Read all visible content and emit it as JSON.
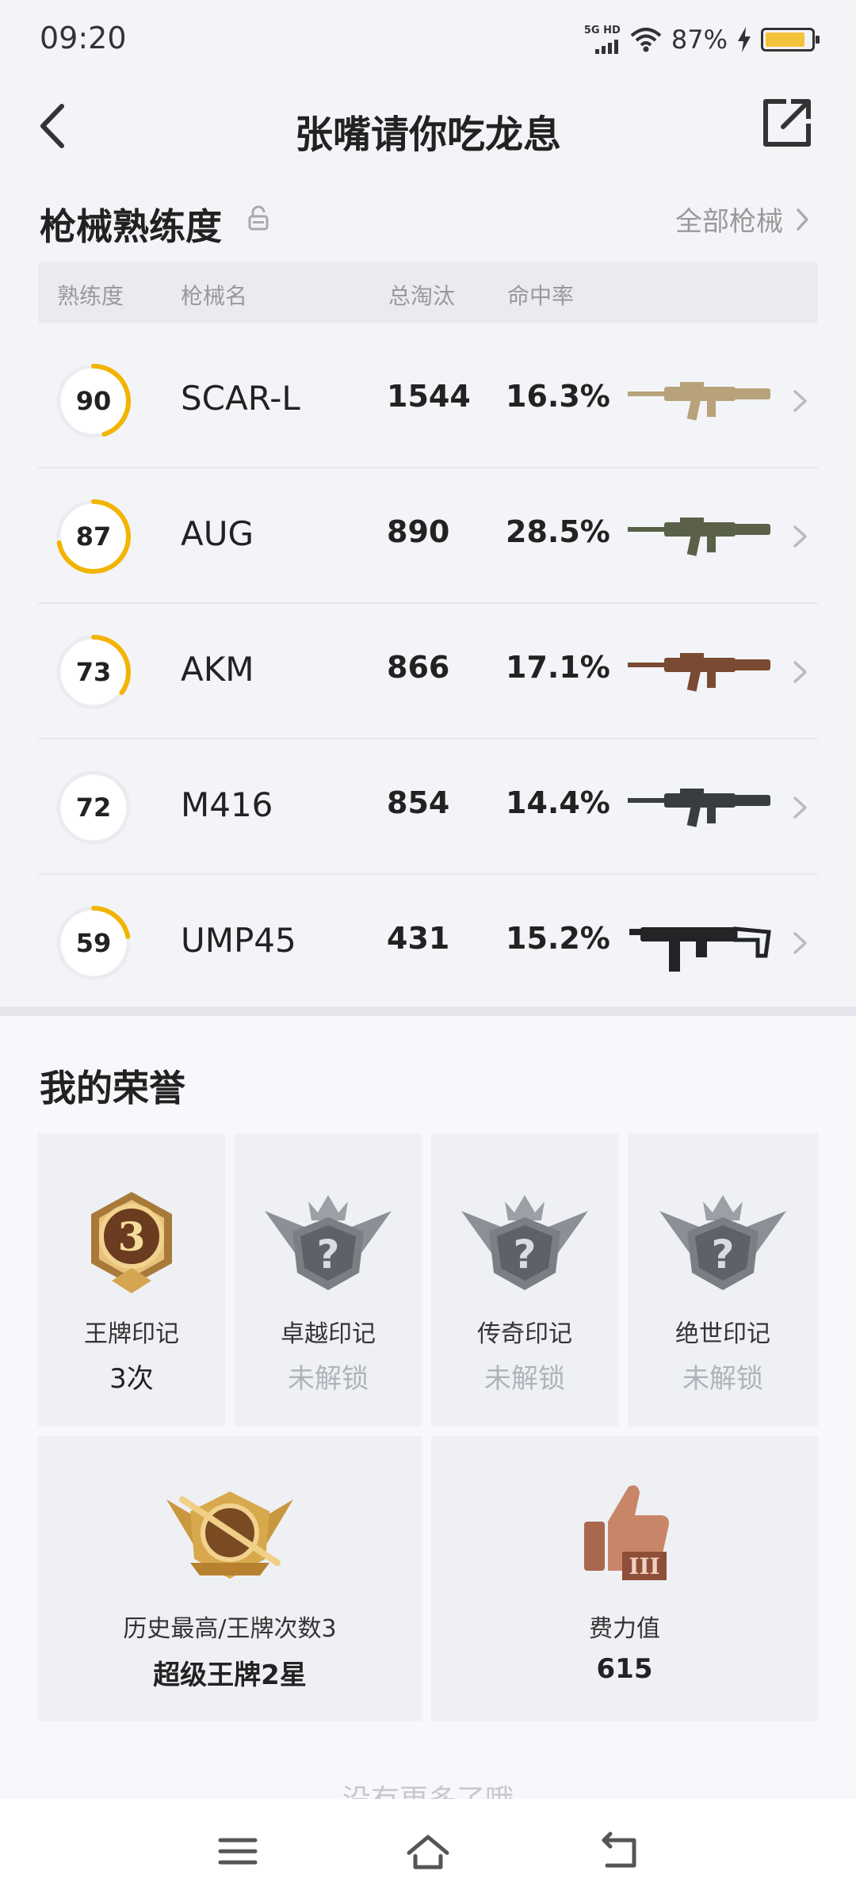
{
  "status": {
    "time": "09:20",
    "network": "5G HD",
    "battery": "87%",
    "battery_level": 0.87
  },
  "header": {
    "title": "张嘴请你吃龙息",
    "back_icon": "chevron-left-icon",
    "share_icon": "share-external-icon"
  },
  "weapons": {
    "section_title": "枪械熟练度",
    "all_link": "全部枪械",
    "columns": [
      "熟练度",
      "枪械名",
      "总淘汰",
      "命中率"
    ],
    "rows": [
      {
        "mastery": "90",
        "mastery_level": 0.45,
        "name": "SCAR-L",
        "kills": "1544",
        "hit_rate": "16.3%",
        "gun_color": "#b8a27a"
      },
      {
        "mastery": "87",
        "mastery_level": 0.72,
        "name": "AUG",
        "kills": "890",
        "hit_rate": "28.5%",
        "gun_color": "#5a6148"
      },
      {
        "mastery": "73",
        "mastery_level": 0.35,
        "name": "AKM",
        "kills": "866",
        "hit_rate": "17.1%",
        "gun_color": "#7a4a32"
      },
      {
        "mastery": "72",
        "mastery_level": 0.0,
        "name": "M416",
        "kills": "854",
        "hit_rate": "14.4%",
        "gun_color": "#3a3d40"
      },
      {
        "mastery": "59",
        "mastery_level": 0.22,
        "name": "UMP45",
        "kills": "431",
        "hit_rate": "15.2%",
        "gun_color": "#222426"
      }
    ]
  },
  "honors": {
    "section_title": "我的荣誉",
    "marks": [
      {
        "label": "王牌印记",
        "value": "3次",
        "badge_number": "3",
        "unlocked": true,
        "icon": "ace-badge-icon"
      },
      {
        "label": "卓越印记",
        "value": "未解锁",
        "badge_number": "?",
        "unlocked": false,
        "icon": "locked-badge-icon"
      },
      {
        "label": "传奇印记",
        "value": "未解锁",
        "badge_number": "?",
        "unlocked": false,
        "icon": "locked-badge-icon"
      },
      {
        "label": "绝世印记",
        "value": "未解锁",
        "badge_number": "?",
        "unlocked": false,
        "icon": "locked-badge-icon"
      }
    ],
    "best": {
      "label": "历史最高/王牌次数3",
      "value": "超级王牌2星",
      "icon": "super-ace-emblem-icon"
    },
    "effort": {
      "label": "费力值",
      "value": "615",
      "icon": "thumbs-up-icon"
    },
    "footer": "没有更多了哦"
  },
  "navbar": {
    "menu_icon": "menu-icon",
    "home_icon": "home-icon",
    "back_icon": "back-icon"
  },
  "colors": {
    "accent_yellow": "#f2b400",
    "ring_track": "#ececf0",
    "page_bg": "#f3f4f8"
  }
}
